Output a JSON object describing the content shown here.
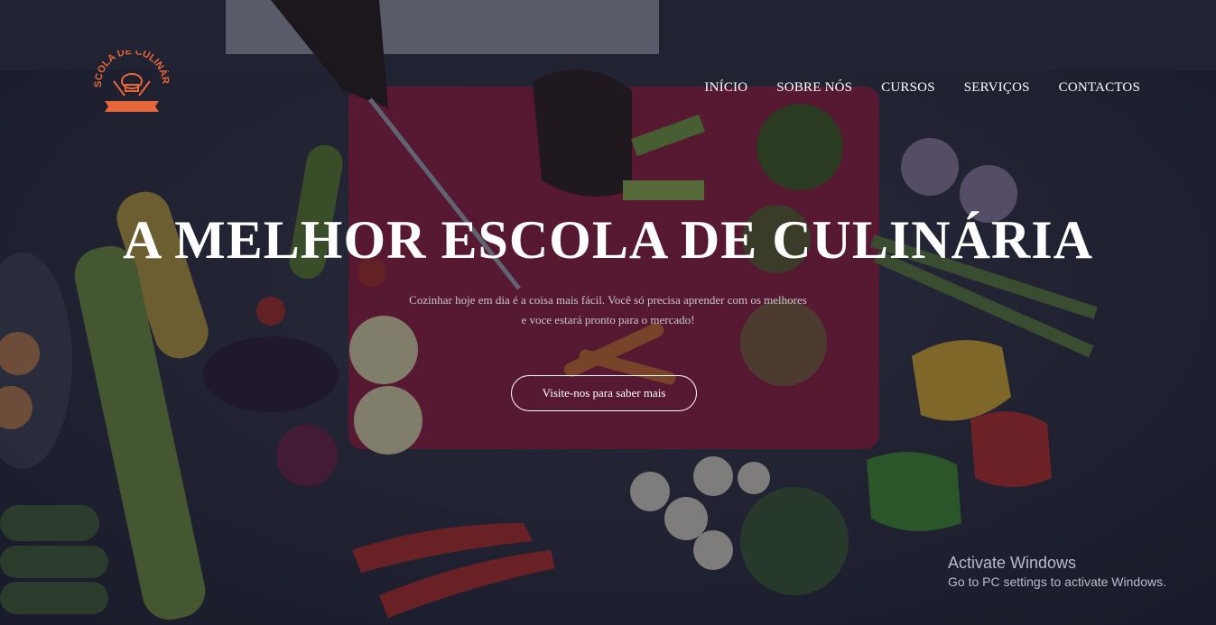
{
  "logo": {
    "text_top": "ESCOLA DE CULINÁRIA",
    "ribbon_text": "",
    "icon": "chef-hat-icon",
    "color": "#e5673a"
  },
  "nav": {
    "items": [
      {
        "label": "INÍCIO"
      },
      {
        "label": "SOBRE NÓS"
      },
      {
        "label": "CURSOS"
      },
      {
        "label": "SERVIÇOS"
      },
      {
        "label": "CONTACTOS"
      }
    ]
  },
  "hero": {
    "title": "A MELHOR ESCOLA DE CULINÁRIA",
    "subtitle_line1": "Cozinhar hoje em dia é a coisa mais fácil. Você só precisa aprender com os melhores",
    "subtitle_line2": "e voce estará pronto para o mercado!",
    "cta_label": "Visite-nos para saber mais"
  },
  "watermark": {
    "title": "Activate Windows",
    "subtitle": "Go to PC settings to activate Windows."
  },
  "colors": {
    "overlay": "#141628",
    "board": "#8e1d3a",
    "accent": "#e5673a"
  }
}
